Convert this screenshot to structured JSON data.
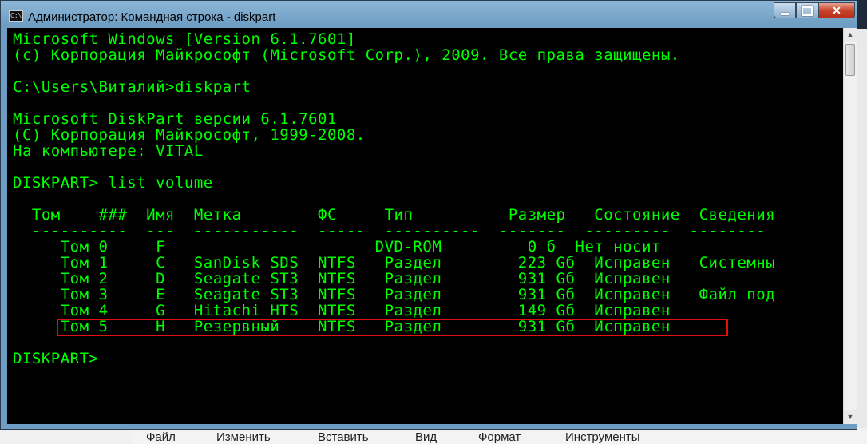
{
  "window": {
    "title": "Администратор: Командная строка - diskpart"
  },
  "console_lines": [
    "Microsoft Windows [Version 6.1.7601]",
    "(c) Корпорация Майкрософт (Microsoft Corp.), 2009. Все права защищены.",
    "",
    "C:\\Users\\Виталий>diskpart",
    "",
    "Microsoft DiskPart версии 6.1.7601",
    "(C) Корпорация Майкрософт, 1999-2008.",
    "На компьютере: VITAL",
    "",
    "DISKPART> list volume",
    "",
    "  Том    ###  Имя  Метка        ФС     Тип          Размер   Состояние  Сведения",
    "  ----------  ---  -----------  -----  ----------  -------  ---------  --------",
    "     Том 0     F                      DVD-ROM         0 б  Нет носит",
    "     Том 1     C   SanDisk SDS  NTFS   Раздел        223 Gб  Исправен   Системны",
    "     Том 2     D   Seagate ST3  NTFS   Раздел        931 Gб  Исправен",
    "     Том 3     E   Seagate ST3  NTFS   Раздел        931 Gб  Исправен   Файл под",
    "     Том 4     G   Hitachi HTS  NTFS   Раздел        149 Gб  Исправен",
    "     Том 5     H   Резервный    NTFS   Раздел        931 Gб  Исправен",
    "",
    "DISKPART>"
  ],
  "background_menu": [
    "Файл",
    "Изменить",
    "Вставить",
    "Вид",
    "Формат",
    "Инструменты"
  ],
  "colors": {
    "console_bg": "#000000",
    "console_text": "#00ff00",
    "highlight_border": "#e01010"
  },
  "icons": {
    "app": "cmd-icon",
    "minimize": "minimize-icon",
    "maximize": "maximize-icon",
    "close": "close-icon"
  }
}
